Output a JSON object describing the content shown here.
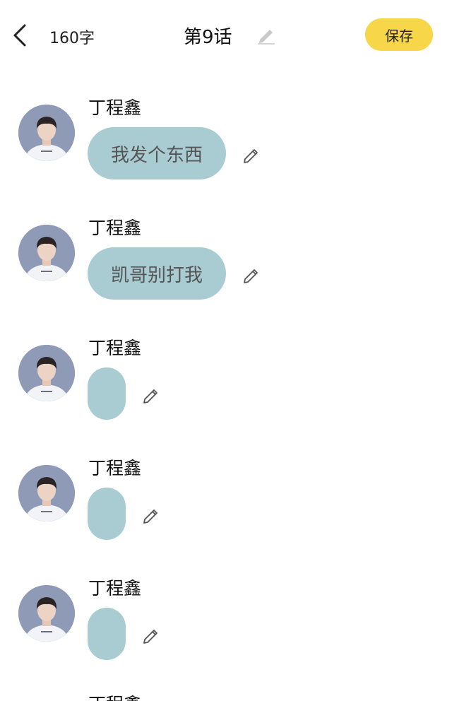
{
  "header": {
    "back_icon": "chevron-left-icon",
    "word_count": "160字",
    "chapter_title": "第9话",
    "title_edit_icon": "pencil-icon",
    "save_label": "保存"
  },
  "colors": {
    "bubble": "#a9cbd2",
    "save_button": "#f7d64a",
    "bubble_text": "#555555"
  },
  "messages": [
    {
      "sender": "丁程鑫",
      "text": "我发个东西"
    },
    {
      "sender": "丁程鑫",
      "text": "凯哥别打我"
    },
    {
      "sender": "丁程鑫",
      "text": ""
    },
    {
      "sender": "丁程鑫",
      "text": ""
    },
    {
      "sender": "丁程鑫",
      "text": ""
    },
    {
      "sender": "丁程鑫",
      "text": ""
    }
  ]
}
